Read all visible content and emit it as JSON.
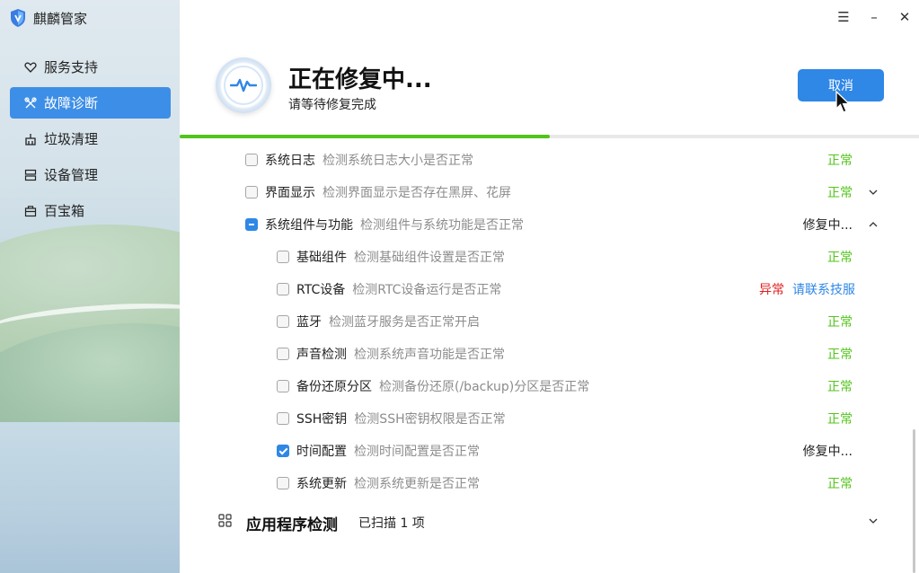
{
  "app": {
    "name": "麒麟管家"
  },
  "sidebar": {
    "items": [
      {
        "label": "服务支持",
        "icon": "heart-icon",
        "active": false
      },
      {
        "label": "故障诊断",
        "icon": "tools-icon",
        "active": true
      },
      {
        "label": "垃圾清理",
        "icon": "broom-icon",
        "active": false
      },
      {
        "label": "设备管理",
        "icon": "server-icon",
        "active": false
      },
      {
        "label": "百宝箱",
        "icon": "toolbox-icon",
        "active": false
      }
    ]
  },
  "window_controls": {
    "menu": "☰",
    "minimize": "–",
    "close": "✕"
  },
  "header": {
    "title": "正在修复中...",
    "subtitle": "请等待修复完成",
    "cancel_label": "取消"
  },
  "progress": {
    "fraction": 0.5
  },
  "checks": [
    {
      "name": "系统日志",
      "desc": "检测系统日志大小是否正常",
      "status": "正常",
      "kind": "ok",
      "indent": 0,
      "check": "none"
    },
    {
      "name": "界面显示",
      "desc": "检测界面显示是否存在黑屏、花屏",
      "status": "正常",
      "kind": "ok",
      "indent": 0,
      "check": "none",
      "chevron": "down"
    },
    {
      "name": "系统组件与功能",
      "desc": "检测组件与系统功能是否正常",
      "status": "修复中...",
      "kind": "busy",
      "indent": 0,
      "check": "partial",
      "chevron": "up"
    },
    {
      "name": "基础组件",
      "desc": "检测基础组件设置是否正常",
      "status": "正常",
      "kind": "ok",
      "indent": 1,
      "check": "none"
    },
    {
      "name": "RTC设备",
      "desc": "检测RTC设备运行是否正常",
      "status": "异常",
      "kind": "err",
      "indent": 1,
      "check": "none",
      "link": "请联系技服"
    },
    {
      "name": "蓝牙",
      "desc": "检测蓝牙服务是否正常开启",
      "status": "正常",
      "kind": "ok",
      "indent": 1,
      "check": "none"
    },
    {
      "name": "声音检测",
      "desc": "检测系统声音功能是否正常",
      "status": "正常",
      "kind": "ok",
      "indent": 1,
      "check": "none"
    },
    {
      "name": "备份还原分区",
      "desc": "检测备份还原(/backup)分区是否正常",
      "status": "正常",
      "kind": "ok",
      "indent": 1,
      "check": "none"
    },
    {
      "name": "SSH密钥",
      "desc": "检测SSH密钥权限是否正常",
      "status": "正常",
      "kind": "ok",
      "indent": 1,
      "check": "none"
    },
    {
      "name": "时间配置",
      "desc": "检测时间配置是否正常",
      "status": "修复中...",
      "kind": "busy",
      "indent": 1,
      "check": "checked"
    },
    {
      "name": "系统更新",
      "desc": "检测系统更新是否正常",
      "status": "正常",
      "kind": "ok",
      "indent": 1,
      "check": "none"
    }
  ],
  "app_section": {
    "title": "应用程序检测",
    "count": "已扫描 1 项",
    "icon": "grid-icon"
  }
}
